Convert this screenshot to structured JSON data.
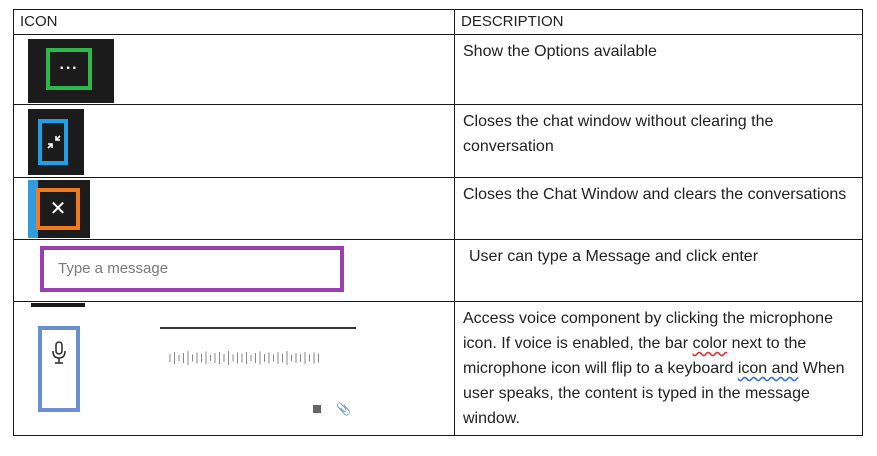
{
  "table": {
    "headers": {
      "icon": "ICON",
      "description": "DESCRIPTION"
    },
    "rows": [
      {
        "icon": "options-icon",
        "icon_glyph": "···",
        "description": "Show the Options available"
      },
      {
        "icon": "minimize-icon",
        "description": "Closes the chat window without clearing the conversation"
      },
      {
        "icon": "close-icon",
        "icon_glyph": "✕",
        "description": "Closes the Chat Window and clears the conversations"
      },
      {
        "icon": "message-input",
        "placeholder": "Type a message",
        "description": "User can type a Message and click enter"
      },
      {
        "icon": "microphone-icon",
        "description_parts": {
          "p1": "Access voice component by clicking the microphone icon. If voice is enabled, the bar ",
          "p2": "color",
          "p3": " next to the microphone icon will flip to a keyboard ",
          "p4": "icon  and",
          "p5": "  When user speaks, the content is typed in the message window."
        }
      }
    ]
  },
  "colors": {
    "options_ring": "#2db84b",
    "minimize_ring": "#1ea0e6",
    "close_ring": "#f07a1e",
    "input_border": "#9b3fb0",
    "mic_border": "#6b8fd1"
  }
}
